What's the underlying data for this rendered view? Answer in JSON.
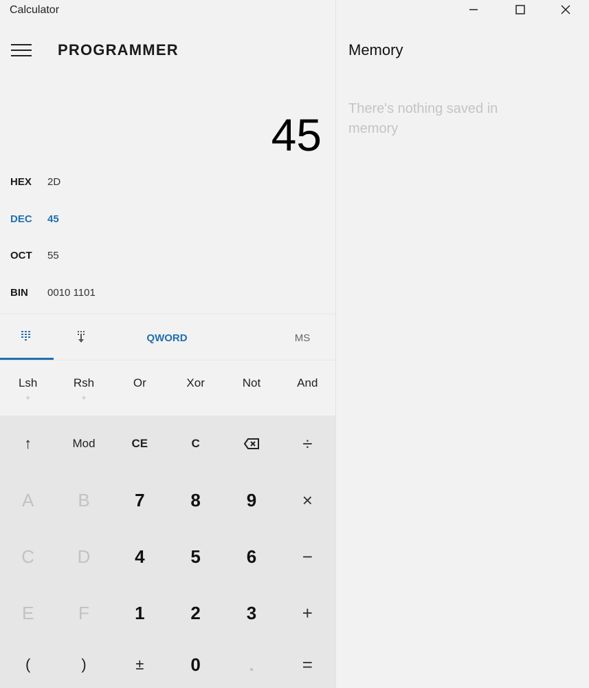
{
  "window": {
    "title": "Calculator"
  },
  "header": {
    "mode": "PROGRAMMER"
  },
  "display": {
    "value": "45"
  },
  "radix": [
    {
      "label": "HEX",
      "value": "2D",
      "active": false
    },
    {
      "label": "DEC",
      "value": "45",
      "active": true
    },
    {
      "label": "OCT",
      "value": "55",
      "active": false
    },
    {
      "label": "BIN",
      "value": "0010 1101",
      "active": false
    }
  ],
  "tabs": {
    "word_size": "QWORD",
    "memory_store": "MS"
  },
  "bitops": [
    {
      "label": "Lsh",
      "sub": "+"
    },
    {
      "label": "Rsh",
      "sub": "+"
    },
    {
      "label": "Or",
      "sub": ""
    },
    {
      "label": "Xor",
      "sub": ""
    },
    {
      "label": "Not",
      "sub": ""
    },
    {
      "label": "And",
      "sub": ""
    }
  ],
  "keys": {
    "row1": [
      "↑",
      "Mod",
      "CE",
      "C",
      "⌫",
      "÷"
    ],
    "row2": [
      "A",
      "B",
      "7",
      "8",
      "9",
      "×"
    ],
    "row3": [
      "C",
      "D",
      "4",
      "5",
      "6",
      "−"
    ],
    "row4": [
      "E",
      "F",
      "1",
      "2",
      "3",
      "+"
    ],
    "row5": [
      "(",
      ")",
      "±",
      "0",
      ".",
      "="
    ]
  },
  "memory": {
    "title": "Memory",
    "empty_text": "There's nothing saved in memory"
  },
  "colors": {
    "accent": "#1f6fb2",
    "background": "#f2f2f2",
    "keypad": "#e6e6e6"
  }
}
